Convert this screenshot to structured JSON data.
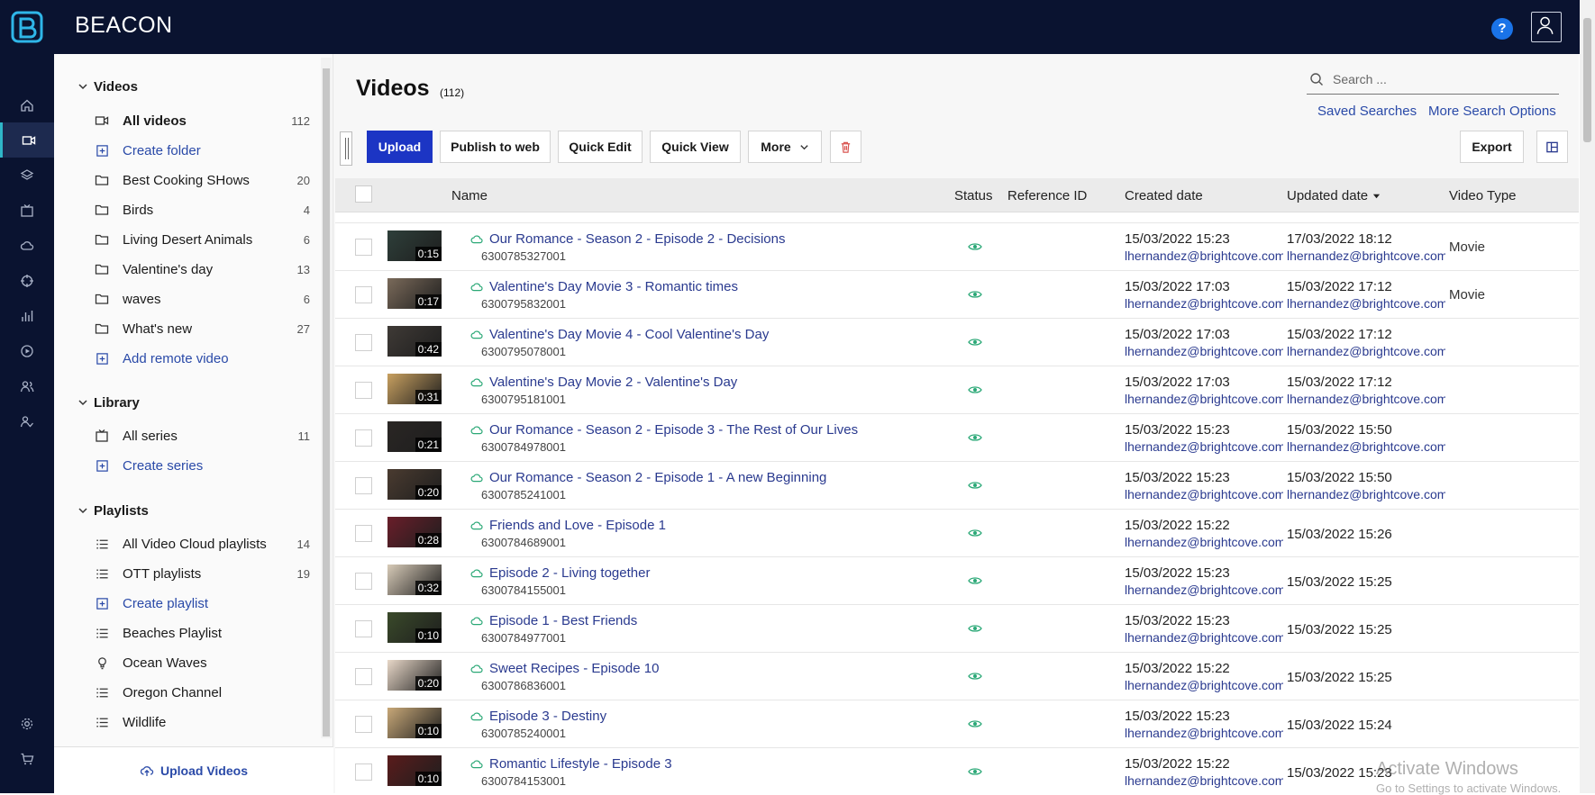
{
  "app": {
    "brand": "BEACON",
    "help_label": "?"
  },
  "sidebar": {
    "videos_heading": "Videos",
    "videos_items": [
      {
        "label": "All videos",
        "count": "112",
        "icon": "video-icon"
      },
      {
        "label": "Create folder",
        "count": "",
        "icon": "plus-box-icon"
      },
      {
        "label": "Best Cooking SHows",
        "count": "20",
        "icon": "folder-icon"
      },
      {
        "label": "Birds",
        "count": "4",
        "icon": "folder-icon"
      },
      {
        "label": "Living Desert Animals",
        "count": "6",
        "icon": "folder-icon"
      },
      {
        "label": "Valentine's day",
        "count": "13",
        "icon": "folder-icon"
      },
      {
        "label": "waves",
        "count": "6",
        "icon": "folder-icon"
      },
      {
        "label": "What's new",
        "count": "27",
        "icon": "folder-icon"
      },
      {
        "label": "Add remote video",
        "count": "",
        "icon": "plus-box-icon"
      }
    ],
    "library_heading": "Library",
    "library_items": [
      {
        "label": "All series",
        "count": "11",
        "icon": "tv-icon"
      },
      {
        "label": "Create series",
        "count": "",
        "icon": "plus-box-icon"
      }
    ],
    "playlists_heading": "Playlists",
    "playlist_items": [
      {
        "label": "All Video Cloud playlists",
        "count": "14",
        "icon": "list-icon"
      },
      {
        "label": "OTT playlists",
        "count": "19",
        "icon": "list-icon"
      },
      {
        "label": "Create playlist",
        "count": "",
        "icon": "plus-box-icon"
      },
      {
        "label": "Beaches Playlist",
        "count": "",
        "icon": "list-icon"
      },
      {
        "label": "Ocean Waves",
        "count": "",
        "icon": "bulb-icon"
      },
      {
        "label": "Oregon Channel",
        "count": "",
        "icon": "list-icon"
      },
      {
        "label": "Wildlife",
        "count": "",
        "icon": "list-icon"
      }
    ],
    "upload_label": "Upload Videos"
  },
  "main": {
    "title": "Videos",
    "count": "(112)",
    "search_placeholder": "Search ...",
    "saved_searches": "Saved Searches",
    "more_search_options": "More Search Options",
    "toolbar": {
      "upload": "Upload",
      "publish": "Publish to web",
      "quick_edit": "Quick Edit",
      "quick_view": "Quick View",
      "more": "More",
      "export": "Export"
    },
    "columns": {
      "name": "Name",
      "status": "Status",
      "reference_id": "Reference ID",
      "created": "Created date",
      "updated": "Updated date",
      "video_type": "Video Type"
    },
    "rows": [
      {
        "name": "Our Romance - Season 2 - Episode 2 - Decisions",
        "id": "6300785327001",
        "duration": "0:15",
        "created": "15/03/2022 15:23",
        "created_by": "lhernandez@brightcove.com",
        "updated": "17/03/2022 18:12",
        "updated_by": "lhernandez@brightcove.com",
        "type": "Movie"
      },
      {
        "name": "Valentine's Day Movie 3 - Romantic times",
        "id": "6300795832001",
        "duration": "0:17",
        "created": "15/03/2022 17:03",
        "created_by": "lhernandez@brightcove.com",
        "updated": "15/03/2022 17:12",
        "updated_by": "lhernandez@brightcove.com",
        "type": "Movie"
      },
      {
        "name": "Valentine's Day Movie 4 - Cool Valentine's Day",
        "id": "6300795078001",
        "duration": "0:42",
        "created": "15/03/2022 17:03",
        "created_by": "lhernandez@brightcove.com",
        "updated": "15/03/2022 17:12",
        "updated_by": "lhernandez@brightcove.com",
        "type": ""
      },
      {
        "name": "Valentine's Day Movie 2 - Valentine's Day",
        "id": "6300795181001",
        "duration": "0:31",
        "created": "15/03/2022 17:03",
        "created_by": "lhernandez@brightcove.com",
        "updated": "15/03/2022 17:12",
        "updated_by": "lhernandez@brightcove.com",
        "type": ""
      },
      {
        "name": "Our Romance - Season 2 - Episode 3 - The Rest of Our Lives",
        "id": "6300784978001",
        "duration": "0:21",
        "created": "15/03/2022 15:23",
        "created_by": "lhernandez@brightcove.com",
        "updated": "15/03/2022 15:50",
        "updated_by": "lhernandez@brightcove.com",
        "type": ""
      },
      {
        "name": "Our Romance - Season 2 - Episode 1 - A new Beginning",
        "id": "6300785241001",
        "duration": "0:20",
        "created": "15/03/2022 15:23",
        "created_by": "lhernandez@brightcove.com",
        "updated": "15/03/2022 15:50",
        "updated_by": "lhernandez@brightcove.com",
        "type": ""
      },
      {
        "name": "Friends and Love - Episode 1",
        "id": "6300784689001",
        "duration": "0:28",
        "created": "15/03/2022 15:22",
        "created_by": "lhernandez@brightcove.com",
        "updated": "15/03/2022 15:26",
        "updated_by": "",
        "type": ""
      },
      {
        "name": "Episode 2 - Living together",
        "id": "6300784155001",
        "duration": "0:32",
        "created": "15/03/2022 15:23",
        "created_by": "lhernandez@brightcove.com",
        "updated": "15/03/2022 15:25",
        "updated_by": "",
        "type": ""
      },
      {
        "name": "Episode 1 - Best Friends",
        "id": "6300784977001",
        "duration": "0:10",
        "created": "15/03/2022 15:23",
        "created_by": "lhernandez@brightcove.com",
        "updated": "15/03/2022 15:25",
        "updated_by": "",
        "type": ""
      },
      {
        "name": "Sweet Recipes - Episode 10",
        "id": "6300786836001",
        "duration": "0:20",
        "created": "15/03/2022 15:22",
        "created_by": "lhernandez@brightcove.com",
        "updated": "15/03/2022 15:25",
        "updated_by": "",
        "type": ""
      },
      {
        "name": "Episode 3 - Destiny",
        "id": "6300785240001",
        "duration": "0:10",
        "created": "15/03/2022 15:23",
        "created_by": "lhernandez@brightcove.com",
        "updated": "15/03/2022 15:24",
        "updated_by": "",
        "type": ""
      },
      {
        "name": "Romantic Lifestyle - Episode 3",
        "id": "6300784153001",
        "duration": "0:10",
        "created": "15/03/2022 15:22",
        "created_by": "lhernandez@brightcove.com",
        "updated": "15/03/2022 15:23",
        "updated_by": "",
        "type": ""
      }
    ]
  },
  "watermark": {
    "line1": "Activate Windows",
    "line2": "Go to Settings to activate Windows."
  },
  "colors": {
    "nav_bg": "#0a1330",
    "accent": "#1c35c4",
    "link": "#2a4aa8",
    "status": "#2aa876"
  }
}
